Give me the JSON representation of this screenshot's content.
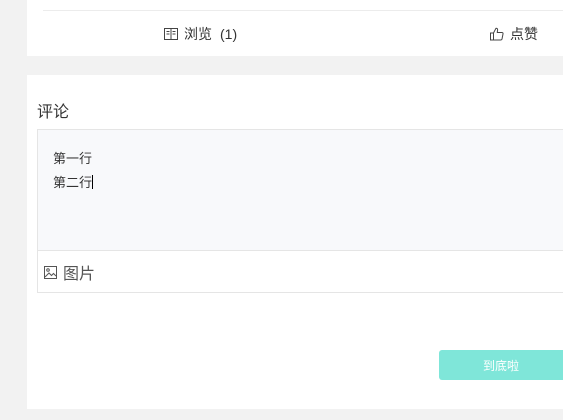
{
  "stats": {
    "views_label": "浏览",
    "views_count": "(1)",
    "like_label": "点赞"
  },
  "icons": {
    "views": "book-open-icon",
    "like": "thumbs-up-icon",
    "image": "image-icon"
  },
  "comment": {
    "title": "评论",
    "lines": [
      "第一行",
      "第二行"
    ],
    "toolbar": {
      "image_label": "图片"
    },
    "submit_label": "到底啦"
  },
  "colors": {
    "submit_button": "#7fe6d9",
    "editor_background": "#f8f9fb",
    "page_background": "#f2f2f2"
  }
}
